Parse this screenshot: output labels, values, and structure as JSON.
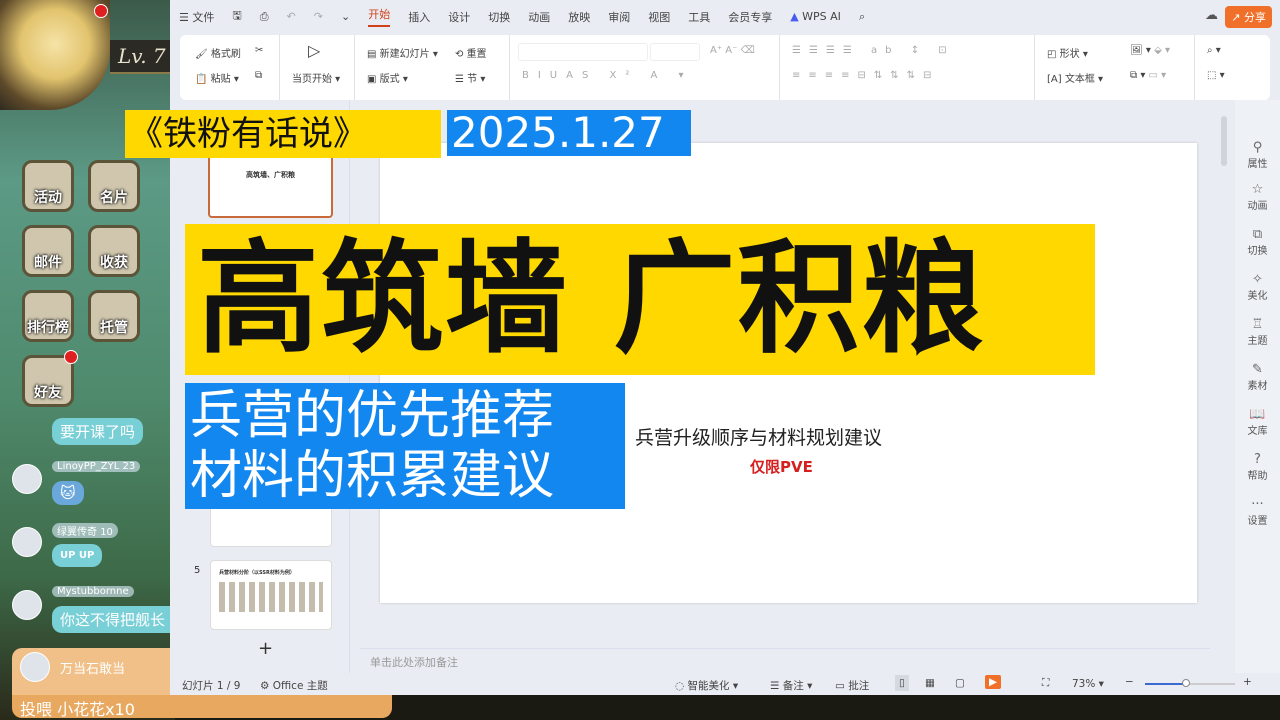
{
  "game": {
    "level": "Lv. 7",
    "buttons": [
      "活动",
      "名片",
      "邮件",
      "收获",
      "排行榜",
      "托管",
      "好友"
    ]
  },
  "wps": {
    "menu": {
      "file": "文件",
      "tabs": [
        "开始",
        "插入",
        "设计",
        "切换",
        "动画",
        "放映",
        "审阅",
        "视图",
        "工具",
        "会员专享"
      ],
      "active_tab": "开始",
      "wps_ai": "WPS AI",
      "share": "分享"
    },
    "ribbon": {
      "format_painter": "格式刷",
      "paste": "粘贴",
      "play_from_current": "当页开始",
      "new_slide": "新建幻灯片",
      "layout": "版式",
      "reset": "重置",
      "section": "节",
      "shape": "形状",
      "textbox": "文本框"
    },
    "thumbnails": {
      "slide1_title": "高筑墙、广积粮",
      "slide5_number": "5",
      "slide5_title": "兵营材料分阶（以SSR材料为例）",
      "add": "+"
    },
    "slide": {
      "subtitle": "兵营升级顺序与材料规划建议",
      "tag": "仅限PVE"
    },
    "notes_placeholder": "单击此处添加备注",
    "status": {
      "slide_counter": "幻灯片 1 / 9",
      "theme": "Office 主题",
      "smart_beautify": "智能美化",
      "notes": "备注",
      "comments": "批注",
      "zoom": "73%",
      "zoom_fraction": 0.45
    },
    "side_panel": [
      "属性",
      "动画",
      "切换",
      "美化",
      "主题",
      "素材",
      "文库",
      "帮助",
      "设置"
    ]
  },
  "overlay": {
    "series": "《铁粉有话说》",
    "date": "2025.1.27",
    "headline": "高筑墙 广积粮",
    "sub1": "兵营的优先推荐",
    "sub2": "材料的积累建议"
  },
  "chat": [
    {
      "user": "",
      "msg": "要开课了吗"
    },
    {
      "user": "LinoyPP_ZYL",
      "badge": "23",
      "msg": "🐱"
    },
    {
      "user": "绿翼传奇",
      "badge": "10",
      "msg": "UP UP"
    },
    {
      "user": "Mystubbornne",
      "msg": "你这不得把舰长"
    }
  ],
  "gift": {
    "user": "万当石敢当",
    "text": "投喂 小花花x10"
  },
  "colors": {
    "accent": "#d0421b",
    "share": "#f0702a",
    "overlay_yellow": "#ffd800",
    "overlay_blue": "#1287f0",
    "pve_red": "#d62020"
  }
}
